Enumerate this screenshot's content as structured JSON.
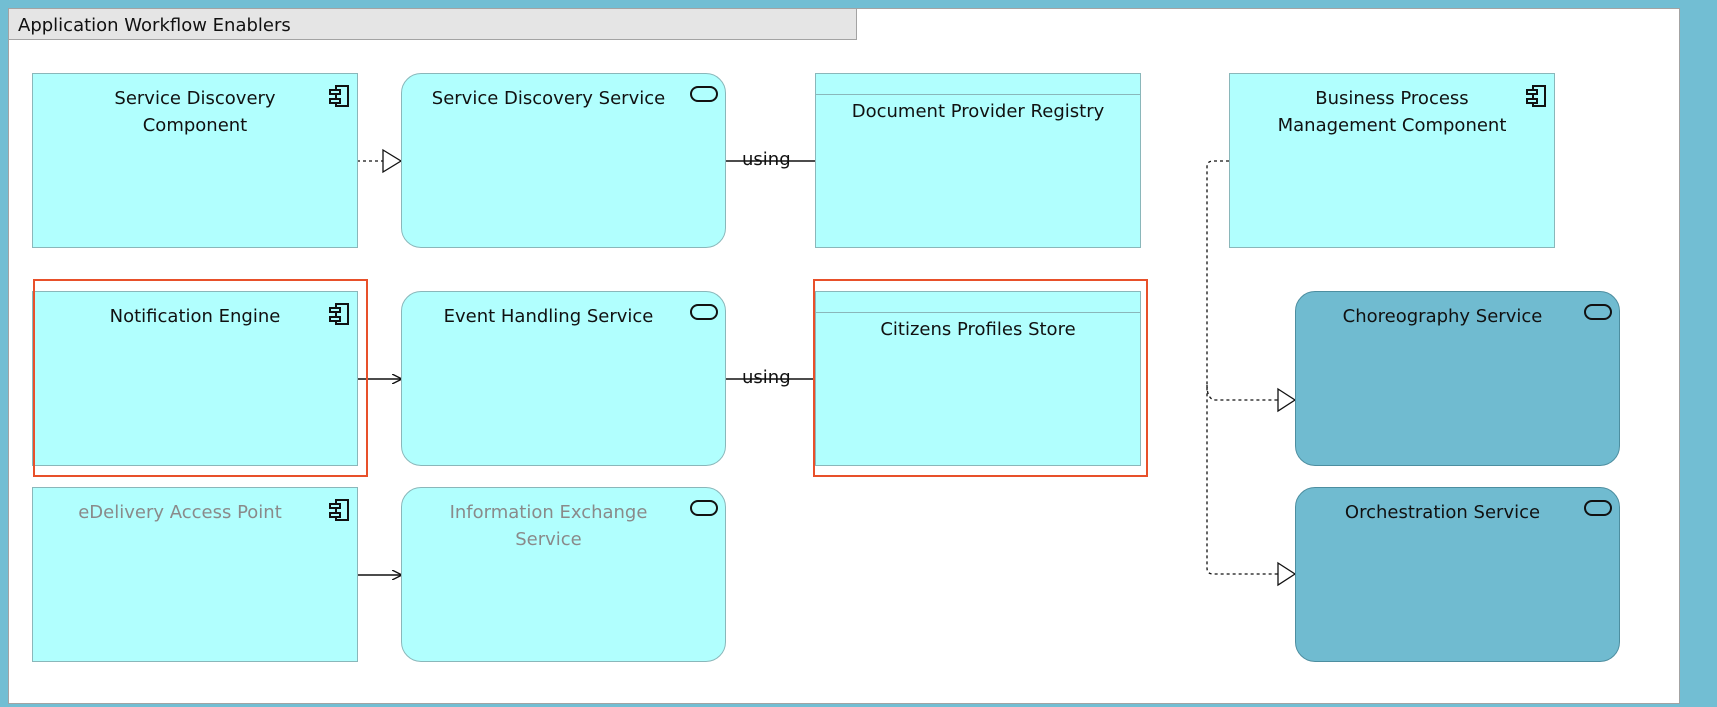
{
  "group": {
    "title": "Application Workflow Enablers"
  },
  "nodes": {
    "service_discovery_component": {
      "label": "Service Discovery\nComponent",
      "type": "application-component"
    },
    "service_discovery_service": {
      "label": "Service Discovery Service",
      "type": "application-service"
    },
    "document_provider_registry": {
      "label": "Document Provider Registry",
      "type": "data-object"
    },
    "bpm_component": {
      "label": "Business Process\nManagement Component",
      "type": "application-component"
    },
    "notification_engine": {
      "label": "Notification Engine",
      "type": "application-component",
      "selected": true
    },
    "event_handling_service": {
      "label": "Event Handling Service",
      "type": "application-service"
    },
    "citizens_profiles_store": {
      "label": "Citizens Profiles Store",
      "type": "data-object",
      "selected": true
    },
    "choreography_service": {
      "label": "Choreography Service",
      "type": "application-service"
    },
    "edelivery_access_point": {
      "label": "eDelivery Access Point",
      "type": "application-component"
    },
    "information_exchange_service": {
      "label": "Information Exchange\nService",
      "type": "application-service"
    },
    "orchestration_service": {
      "label": "Orchestration Service",
      "type": "application-service"
    }
  },
  "connections": {
    "using_1": "using",
    "using_2": "using"
  },
  "colors": {
    "background": "#72bed3",
    "element_fill": "#b1fffe",
    "dark_fill": "#70bbd0",
    "selection": "#e8502a"
  },
  "icons": {
    "component": "application-component-icon",
    "service": "application-service-icon"
  }
}
